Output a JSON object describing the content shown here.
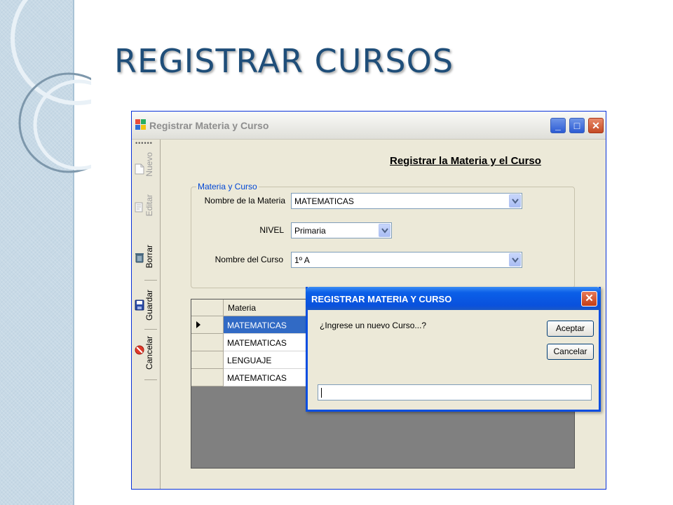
{
  "slide": {
    "title": "REGISTRAR CURSOS"
  },
  "window": {
    "title": "Registrar Materia y Curso",
    "buttons": {
      "minimize": "_",
      "maximize": "□",
      "close": "✕"
    }
  },
  "toolbar": {
    "items": [
      {
        "label": "Nuevo",
        "icon": "new-document-icon",
        "enabled": false
      },
      {
        "label": "Editar",
        "icon": "edit-document-icon",
        "enabled": false
      },
      {
        "label": "Borrar",
        "icon": "trash-icon",
        "enabled": true
      },
      {
        "label": "Guardar",
        "icon": "floppy-disk-icon",
        "enabled": true
      },
      {
        "label": "Cancelar",
        "icon": "cancel-icon",
        "enabled": true
      }
    ]
  },
  "form": {
    "heading": "Registrar la Materia y el Curso",
    "group_title": "Materia y Curso",
    "fields": {
      "materia": {
        "label": "Nombre de la Materia",
        "value": "MATEMATICAS"
      },
      "nivel": {
        "label": "NIVEL",
        "value": "Primaria"
      },
      "curso": {
        "label": "Nombre del Curso",
        "value": "1º A"
      }
    }
  },
  "grid": {
    "column": "Materia",
    "selected_row": 0,
    "rows": [
      "MATEMATICAS",
      "MATEMATICAS",
      "LENGUAJE",
      "MATEMATICAS"
    ]
  },
  "dialog": {
    "title": "REGISTRAR MATERIA Y CURSO",
    "prompt": "¿Ingrese un nuevo Curso...?",
    "accept_label": "Aceptar",
    "cancel_label": "Cancelar",
    "input_value": "",
    "close": "✕"
  },
  "colors": {
    "slide_title": "#1f4e79",
    "selection": "#316ac5",
    "dialog_title_bar": "#0951dd"
  }
}
